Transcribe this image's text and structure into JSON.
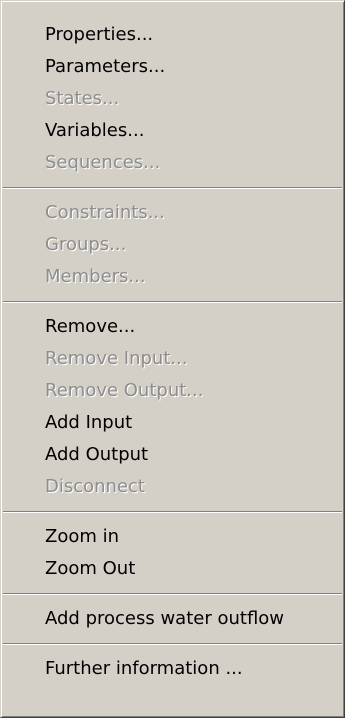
{
  "menu": {
    "items": [
      {
        "label": "Properties...",
        "enabled": true
      },
      {
        "label": "Parameters...",
        "enabled": true
      },
      {
        "label": "States...",
        "enabled": false
      },
      {
        "label": "Variables...",
        "enabled": true
      },
      {
        "label": "Sequences...",
        "enabled": false
      },
      {
        "label": "Constraints...",
        "enabled": false
      },
      {
        "label": "Groups...",
        "enabled": false
      },
      {
        "label": "Members...",
        "enabled": false
      },
      {
        "label": "Remove...",
        "enabled": true
      },
      {
        "label": "Remove Input...",
        "enabled": false
      },
      {
        "label": "Remove Output...",
        "enabled": false
      },
      {
        "label": "Add Input",
        "enabled": true
      },
      {
        "label": "Add Output",
        "enabled": true
      },
      {
        "label": "Disconnect",
        "enabled": false
      },
      {
        "label": "Zoom in",
        "enabled": true
      },
      {
        "label": "Zoom Out",
        "enabled": true
      },
      {
        "label": "Add process water outflow",
        "enabled": true
      },
      {
        "label": "Further information ...",
        "enabled": true
      }
    ]
  }
}
